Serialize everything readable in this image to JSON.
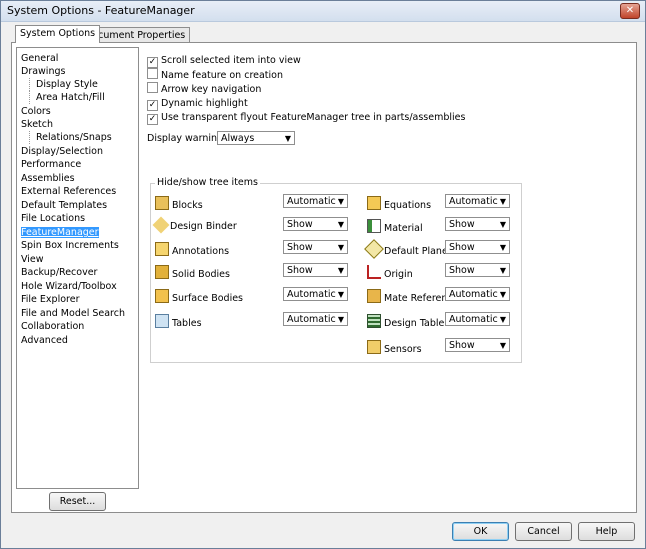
{
  "window": {
    "title": "System Options - FeatureManager",
    "close_glyph": "✕"
  },
  "tabs": [
    {
      "label": "System Options"
    },
    {
      "label": "Document Properties"
    }
  ],
  "tree": {
    "items": [
      {
        "label": "General"
      },
      {
        "label": "Drawings"
      },
      {
        "label": "Display Style"
      },
      {
        "label": "Area Hatch/Fill"
      },
      {
        "label": "Colors"
      },
      {
        "label": "Sketch"
      },
      {
        "label": "Relations/Snaps"
      },
      {
        "label": "Display/Selection"
      },
      {
        "label": "Performance"
      },
      {
        "label": "Assemblies"
      },
      {
        "label": "External References"
      },
      {
        "label": "Default Templates"
      },
      {
        "label": "File Locations"
      },
      {
        "label": "FeatureManager"
      },
      {
        "label": "Spin Box Increments"
      },
      {
        "label": "View"
      },
      {
        "label": "Backup/Recover"
      },
      {
        "label": "Hole Wizard/Toolbox"
      },
      {
        "label": "File Explorer"
      },
      {
        "label": "File and Model Search"
      },
      {
        "label": "Collaboration"
      },
      {
        "label": "Advanced"
      }
    ],
    "reset_label": "Reset..."
  },
  "options": {
    "checkboxes": [
      {
        "label": "Scroll selected item into view",
        "checked": true
      },
      {
        "label": "Name feature on creation",
        "checked": false
      },
      {
        "label": "Arrow key navigation",
        "checked": false
      },
      {
        "label": "Dynamic highlight",
        "checked": true
      },
      {
        "label": "Use transparent flyout FeatureManager tree in parts/assemblies",
        "checked": true
      }
    ],
    "display_warnings_label": "Display warnings:",
    "display_warnings_value": "Always"
  },
  "hide_show": {
    "title": "Hide/show tree items",
    "left": [
      {
        "label": "Blocks",
        "value": "Automatic",
        "icon": "blocks-icon"
      },
      {
        "label": "Design Binder",
        "value": "Show",
        "icon": "design-binder-icon"
      },
      {
        "label": "Annotations",
        "value": "Show",
        "icon": "annotations-icon"
      },
      {
        "label": "Solid Bodies",
        "value": "Show",
        "icon": "solid-bodies-icon"
      },
      {
        "label": "Surface Bodies",
        "value": "Automatic",
        "icon": "surface-bodies-icon"
      },
      {
        "label": "Tables",
        "value": "Automatic",
        "icon": "tables-icon"
      }
    ],
    "right": [
      {
        "label": "Equations",
        "value": "Automatic",
        "icon": "equations-icon"
      },
      {
        "label": "Material",
        "value": "Show",
        "icon": "material-icon"
      },
      {
        "label": "Default Planes",
        "value": "Show",
        "icon": "default-planes-icon"
      },
      {
        "label": "Origin",
        "value": "Show",
        "icon": "origin-icon"
      },
      {
        "label": "Mate References",
        "value": "Automatic",
        "icon": "mate-references-icon"
      },
      {
        "label": "Design Table",
        "value": "Automatic",
        "icon": "design-table-icon"
      },
      {
        "label": "Sensors",
        "value": "Show",
        "icon": "sensors-icon"
      }
    ]
  },
  "buttons": {
    "ok": "OK",
    "cancel": "Cancel",
    "help": "Help"
  }
}
